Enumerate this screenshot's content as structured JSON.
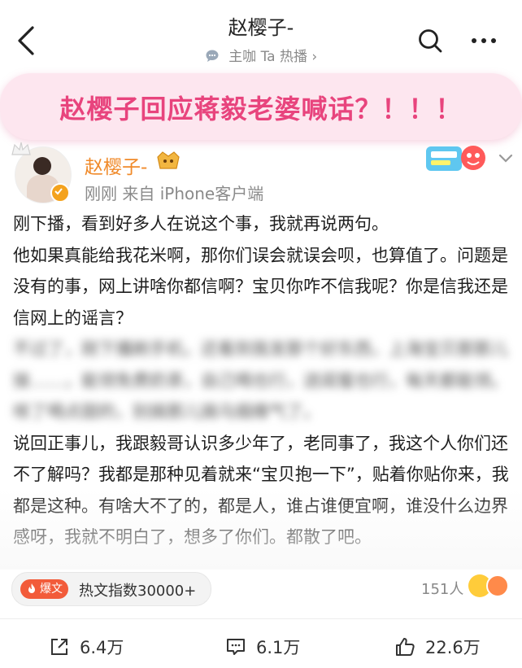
{
  "header": {
    "title": "赵樱子-",
    "subtitle": "主咖 Ta 热播",
    "subtitle_chevron": "›"
  },
  "banner": {
    "text": "赵樱子回应蒋毅老婆喊话？！！！"
  },
  "post": {
    "author": "赵樱子-",
    "meta": "刚刚  来自 iPhone客户端",
    "paragraphs": [
      "刚下播，看到好多人在说这个事，我就再说两句。",
      "他如果真能给我花米啊，那你们误会就误会呗，也算值了。问题是没有的事，网上讲啥你都信啊？宝贝你咋不信我呢？你是信我还是信网上的谣言？",
      "不过了，刚下播刷手机，还看到我发那个好东西，上海宝贝那那儿接……，能领免费奶茶，自己喝也行，送闺蜜也行，每天都能领。咳了喝点甜的，别搞那儿搞乌烟瘴气了。",
      "说回正事儿，我跟毅哥认识多少年了，老同事了，我这个人你们还不了解吗？我都是那种见着就来“宝贝抱一下”，贴着你贴你来，我都是这种。有啥大不了的，都是人，谁占谁便宜啊，谁没什么边界感呀，我就不明白了，想多了你们。都散了吧。"
    ],
    "hot_badge": "爆文",
    "hot_text": "热文指数30000+",
    "likers": "151人"
  },
  "actions": {
    "share": "6.4万",
    "comment": "6.1万",
    "like": "22.6万"
  },
  "colors": {
    "accent": "#e8447d",
    "username": "#f08a2a",
    "banner_bg": "#fde6ef",
    "hot_badge": "#f25b3a"
  },
  "icons": [
    "back-icon",
    "chat-icon",
    "search-icon",
    "more-icon",
    "verified-icon",
    "vip-icon",
    "chevron-down-icon",
    "flame-icon",
    "share-icon",
    "comment-icon",
    "like-icon"
  ]
}
